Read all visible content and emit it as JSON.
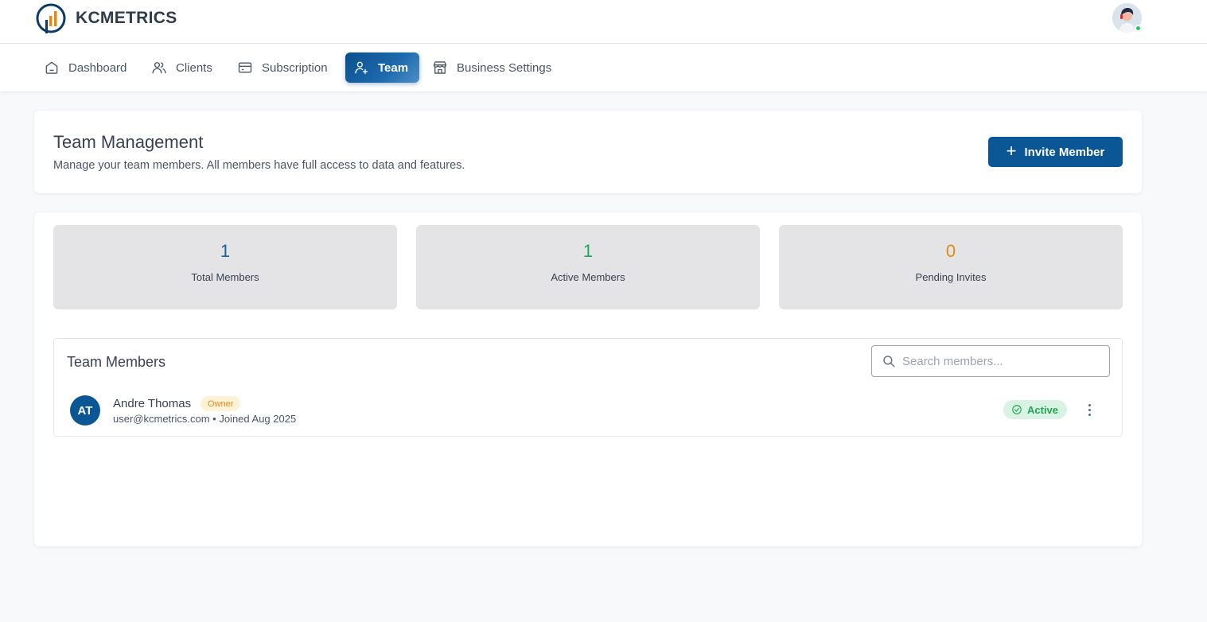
{
  "app": {
    "name": "KCMETRICS"
  },
  "colors": {
    "brand": "#0b5796",
    "total": "#1d5f9e",
    "active": "#22a554",
    "pending": "#e08a13"
  },
  "nav": {
    "items": [
      {
        "label": "Dashboard",
        "icon": "home-icon"
      },
      {
        "label": "Clients",
        "icon": "users-icon"
      },
      {
        "label": "Subscription",
        "icon": "credit-card-icon"
      },
      {
        "label": "Team",
        "icon": "user-plus-icon",
        "active": true
      },
      {
        "label": "Business Settings",
        "icon": "store-icon"
      }
    ]
  },
  "header": {
    "title": "Team Management",
    "subtitle": "Manage your team members. All members have full access to data and features.",
    "invite_label": "Invite Member"
  },
  "stats": [
    {
      "value": "1",
      "label": "Total Members"
    },
    {
      "value": "1",
      "label": "Active Members"
    },
    {
      "value": "0",
      "label": "Pending Invites"
    }
  ],
  "members": {
    "title": "Team Members",
    "search_placeholder": "Search members...",
    "list": [
      {
        "initials": "AT",
        "name": "Andre Thomas",
        "role": "Owner",
        "meta": "user@kcmetrics.com • Joined Aug 2025",
        "status": "Active"
      }
    ]
  }
}
